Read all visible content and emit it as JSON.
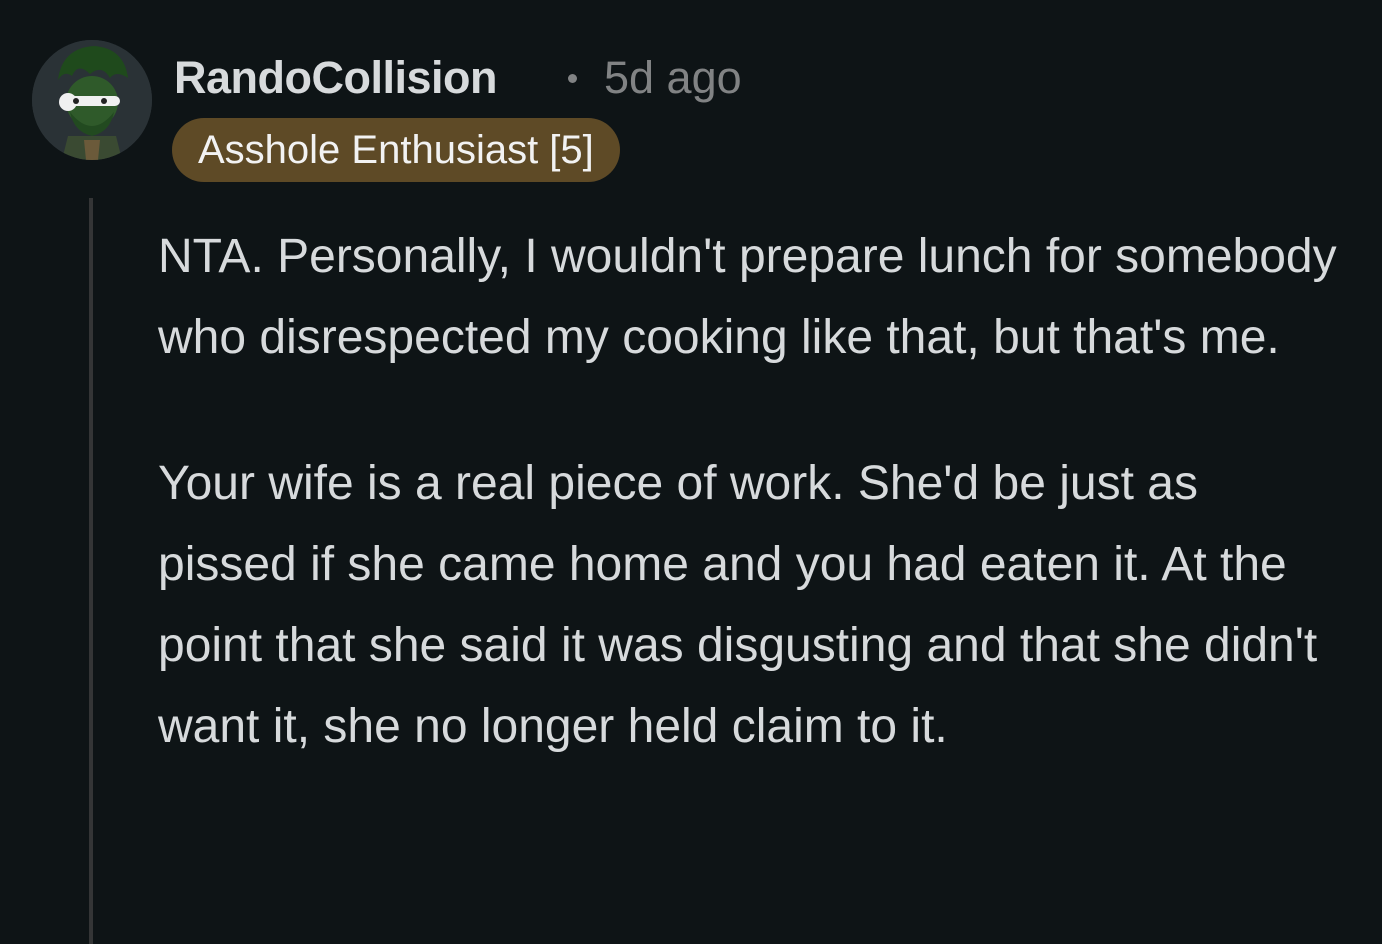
{
  "comment": {
    "avatar_icon": "user-avatar-icon",
    "username": "RandoCollision",
    "separator": "•",
    "timestamp": "5d ago",
    "flair": "Asshole Enthusiast [5]",
    "paragraphs": [
      "NTA. Personally, I wouldn't prepare lunch for somebody who disrespected my cooking like that, but that's me.",
      "Your wife is a real piece of work. She'd be just as pissed if she came home and you had eaten it. At the point that she said it was disgusting and that she didn't want it, she no longer held claim to it."
    ]
  },
  "colors": {
    "background": "#0e1416",
    "text": "#d7dadc",
    "meta": "#818384",
    "flair_background": "#5e4a26",
    "thread_line": "#343536"
  }
}
